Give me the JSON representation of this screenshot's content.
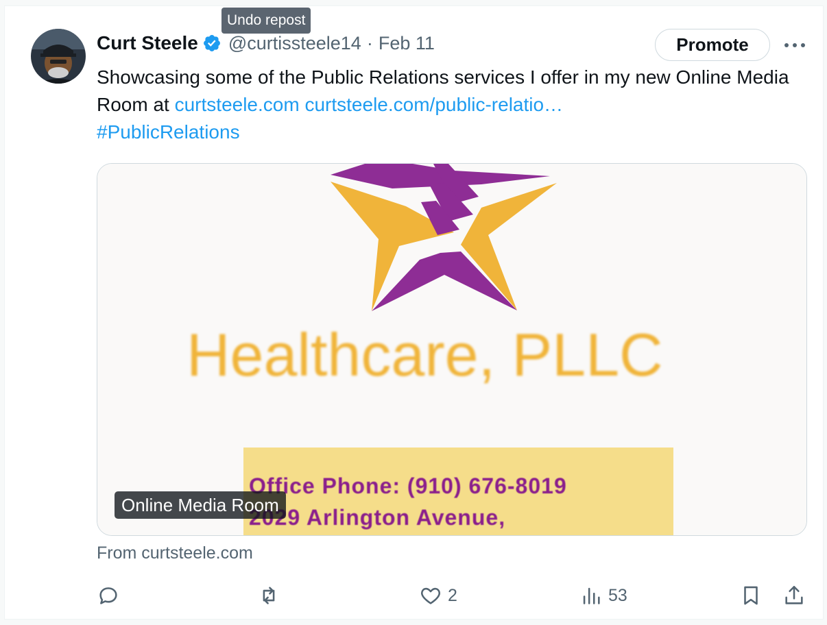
{
  "tooltip": "Undo repost",
  "author": {
    "name": "Curt Steele",
    "handle": "@curtissteele14",
    "separator": "·",
    "date": "Feb 11"
  },
  "promote_label": "Promote",
  "tweet": {
    "text_before": "Showcasing some of the Public Relations services I offer in my new Online Media Room at ",
    "link1": "curtsteele.com",
    "space": " ",
    "link2": "curtsteele.com/public-relatio…",
    "hashtag": "#PublicRelations"
  },
  "card": {
    "image_brand_text": "Healthcare, PLLC",
    "image_line1": "Office Phone:  (910) 676-8019",
    "image_line2": "2029 Arlington Avenue,",
    "title": "Online Media Room",
    "source": "From curtsteele.com"
  },
  "actions": {
    "likes": "2",
    "views": "53"
  },
  "colors": {
    "link": "#1d9bf0",
    "verified": "#1d9bf0",
    "star_purple": "#8e2d95",
    "star_gold": "#f0b43a"
  }
}
